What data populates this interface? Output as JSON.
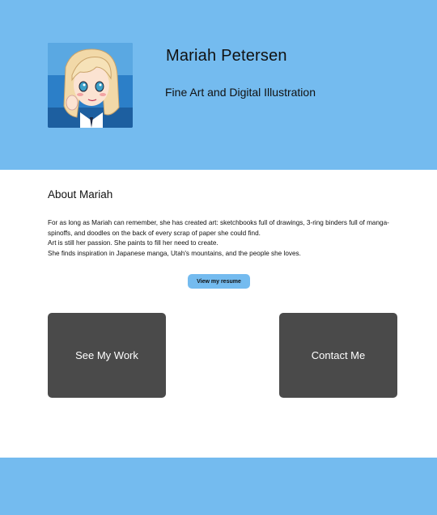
{
  "header": {
    "name": "Mariah Petersen",
    "tagline": "Fine Art and Digital Illustration",
    "accent_color": "#74bbef"
  },
  "avatar": {
    "icon": "portrait-illustration-icon"
  },
  "about": {
    "heading": "About Mariah",
    "paragraphs": [
      "For as long as Mariah can remember, she has created art: sketchbooks full of drawings, 3-ring binders full of manga-spinoffs, and doodles on the back of every scrap of paper she could find.",
      "Art is still her passion. She paints to fill her need to create.",
      "She finds inspiration in Japanese manga, Utah's mountains, and the people she loves."
    ]
  },
  "buttons": {
    "resume_label": "View my resume",
    "work_label": "See My Work",
    "contact_label": "Contact Me",
    "card_color": "#4a4a4a"
  }
}
